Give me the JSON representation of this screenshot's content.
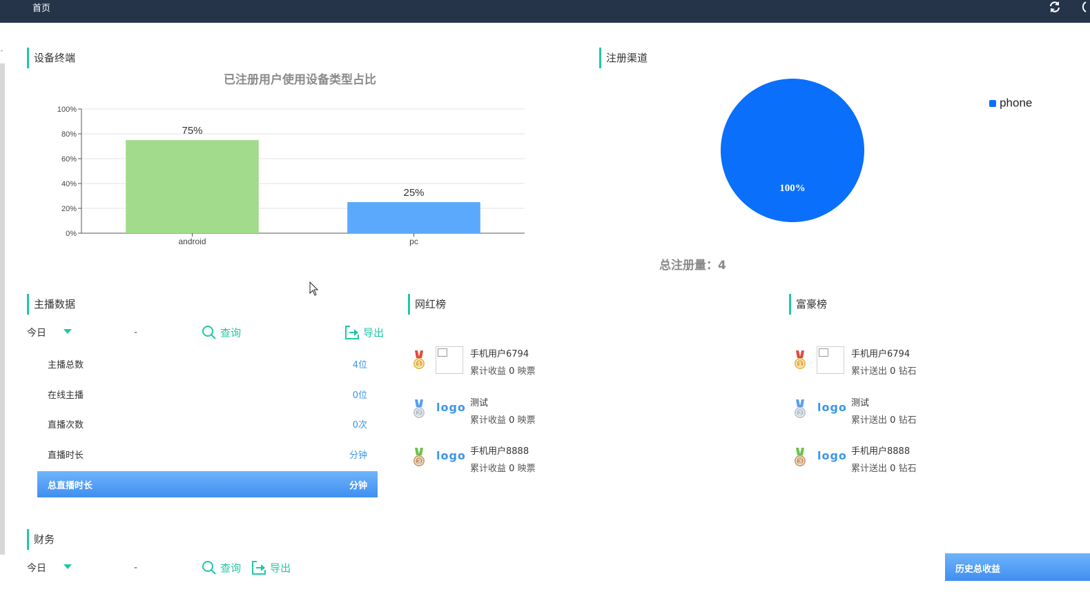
{
  "topbar": {
    "home_tab": "首页"
  },
  "device_section": {
    "title": "设备终端",
    "chart_title": "已注册用户使用设备类型占比"
  },
  "chart_data": [
    {
      "type": "bar",
      "title": "已注册用户使用设备类型占比",
      "categories": [
        "android",
        "pc"
      ],
      "values": [
        75,
        25
      ],
      "data_labels": [
        "75%",
        "25%"
      ],
      "ytick_labels": [
        "0%",
        "20%",
        "40%",
        "60%",
        "80%",
        "100%"
      ],
      "ylim": [
        0,
        100
      ],
      "grid": true,
      "colors": [
        "#a3db8c",
        "#5aa9fd"
      ]
    },
    {
      "type": "pie",
      "categories": [
        "phone"
      ],
      "values": [
        100
      ],
      "data_labels": [
        "100%"
      ],
      "legend": "top-right",
      "colors": [
        "#0a6ffb"
      ]
    }
  ],
  "channel_section": {
    "title": "注册渠道",
    "legend_label": "phone",
    "slice_label": "100%",
    "total_label": "总注册量：4"
  },
  "anchor_section": {
    "title": "主播数据",
    "period": "今日",
    "range_sep": "-",
    "query_label": "查询",
    "export_label": "导出",
    "stats": [
      {
        "label": "主播总数",
        "value": "4位"
      },
      {
        "label": "在线主播",
        "value": "0位"
      },
      {
        "label": "直播次数",
        "value": "0次"
      },
      {
        "label": "直播时长",
        "value": "分钟"
      },
      {
        "label": "总直播时长",
        "value": "分钟"
      }
    ]
  },
  "star_section": {
    "title": "网红榜",
    "items": [
      {
        "rank": "1",
        "name": "手机用户6794",
        "metric": "累计收益",
        "amount": "0",
        "unit": "映票",
        "logo": ""
      },
      {
        "rank": "2",
        "name": "测试",
        "metric": "累计收益",
        "amount": "0",
        "unit": "映票",
        "logo": "logo"
      },
      {
        "rank": "3",
        "name": "手机用户8888",
        "metric": "累计收益",
        "amount": "0",
        "unit": "映票",
        "logo": "logo"
      }
    ]
  },
  "rich_section": {
    "title": "富豪榜",
    "items": [
      {
        "rank": "1",
        "name": "手机用户6794",
        "metric": "累计送出",
        "amount": "0",
        "unit": "钻石",
        "logo": ""
      },
      {
        "rank": "2",
        "name": "测试",
        "metric": "累计送出",
        "amount": "0",
        "unit": "钻石",
        "logo": "logo"
      },
      {
        "rank": "3",
        "name": "手机用户8888",
        "metric": "累计送出",
        "amount": "0",
        "unit": "钻石",
        "logo": "logo"
      }
    ]
  },
  "finance_section": {
    "title": "财务",
    "period": "今日",
    "range_sep": "-",
    "query_label": "查询",
    "export_label": "导出",
    "income_button": "历史总收益"
  },
  "colors": {
    "accent": "#1ec8a5",
    "topbar": "#253449",
    "link_blue": "#3b95e8",
    "highlight_row": "#4f9bf5",
    "medal_gold": "#e8b64a",
    "medal_silver": "#b9c3cf",
    "medal_bronze": "#c89c72"
  },
  "icons": [
    "refresh-icon",
    "dropdown-caret-icon",
    "search-icon",
    "export-icon",
    "medal-icon",
    "cursor-icon"
  ]
}
